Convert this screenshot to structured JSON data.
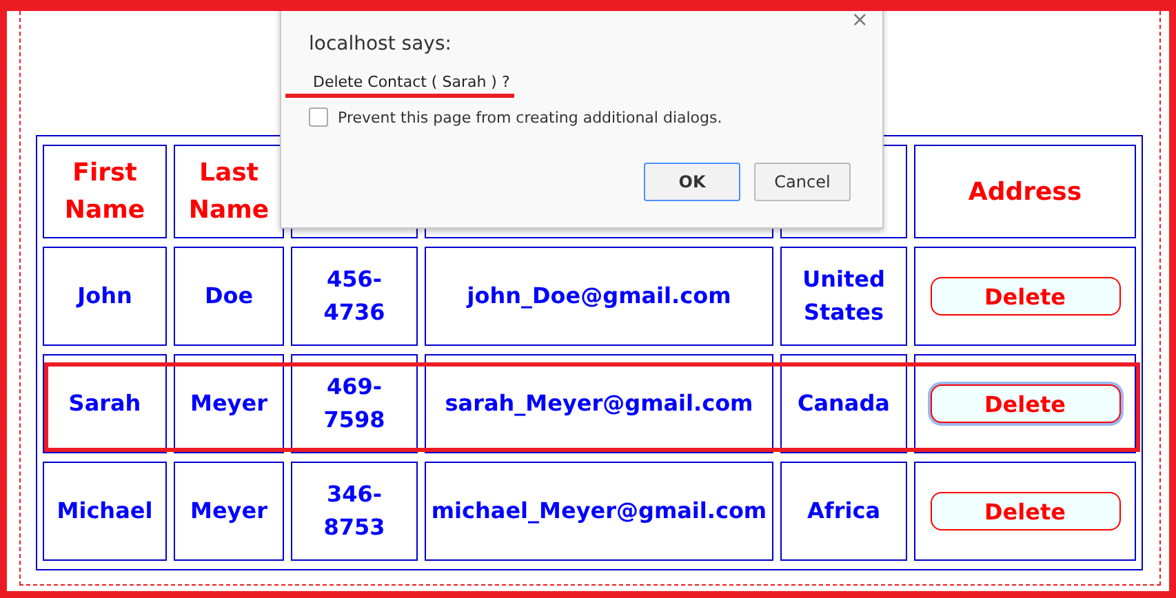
{
  "table": {
    "columns": [
      {
        "label": "First Name"
      },
      {
        "label": "Last Name"
      },
      {},
      {},
      {},
      {
        "label": "Address"
      }
    ],
    "rows": [
      {
        "cells": [
          "John",
          "Doe",
          "456-4736",
          "john_Doe@gmail.com",
          "United States"
        ],
        "action": "Delete",
        "focused": false
      },
      {
        "cells": [
          "Sarah",
          "Meyer",
          "469-7598",
          "sarah_Meyer@gmail.com",
          "Canada"
        ],
        "action": "Delete",
        "focused": true
      },
      {
        "cells": [
          "Michael",
          "Meyer",
          "346-8753",
          "michael_Meyer@gmail.com",
          "Africa"
        ],
        "action": "Delete",
        "focused": false
      }
    ]
  },
  "dialog": {
    "title": "localhost says:",
    "close": "×",
    "message": "Delete Contact ( Sarah ) ?",
    "checkbox": {
      "label": "Prevent this page from creating additional dialogs.",
      "checked": false
    },
    "buttons": [
      {
        "label": "OK",
        "default": true
      },
      {
        "label": "Cancel",
        "default": false
      }
    ]
  }
}
